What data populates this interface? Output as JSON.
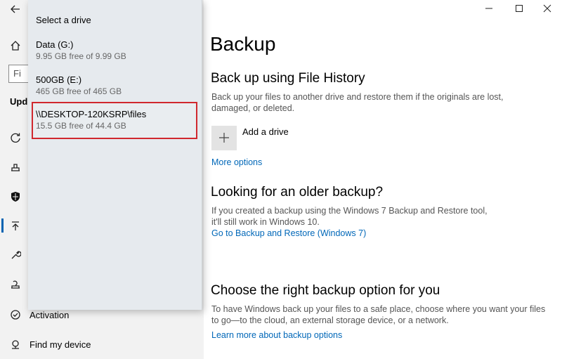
{
  "nav": {
    "search_placeholder": "Fi",
    "heading": "Upd",
    "items": [
      {
        "icon": "activation-icon",
        "label": "Activation"
      },
      {
        "icon": "find-my-device-icon",
        "label": "Find my device"
      }
    ]
  },
  "flyout": {
    "title": "Select a drive",
    "drives": [
      {
        "name": "Data (G:)",
        "free": "9.95 GB free of 9.99 GB"
      },
      {
        "name": "500GB (E:)",
        "free": "465 GB free of 465 GB"
      },
      {
        "name": "\\\\DESKTOP-120KSRP\\files",
        "free": "15.5 GB free of 44.4 GB"
      }
    ],
    "highlight_color": "#d0282e"
  },
  "main": {
    "title": "Backup",
    "file_history": {
      "heading": "Back up using File History",
      "description": "Back up your files to another drive and restore them if the originals are lost, damaged, or deleted.",
      "add_drive_label": "Add a drive",
      "more_options": "More options"
    },
    "older_backup": {
      "heading": "Looking for an older backup?",
      "description": "If you created a backup using the Windows 7 Backup and Restore tool, it'll still work in Windows 10.",
      "link": "Go to Backup and Restore (Windows 7)"
    },
    "right_option": {
      "heading": "Choose the right backup option for you",
      "description": "To have Windows back up your files to a safe place, choose where you want your files to go—to the cloud, an external storage device, or a network.",
      "link": "Learn more about backup options"
    }
  },
  "colors": {
    "accent": "#0067b8",
    "nav_background": "#f2f2f2",
    "flyout_background": "#e6eaee"
  }
}
